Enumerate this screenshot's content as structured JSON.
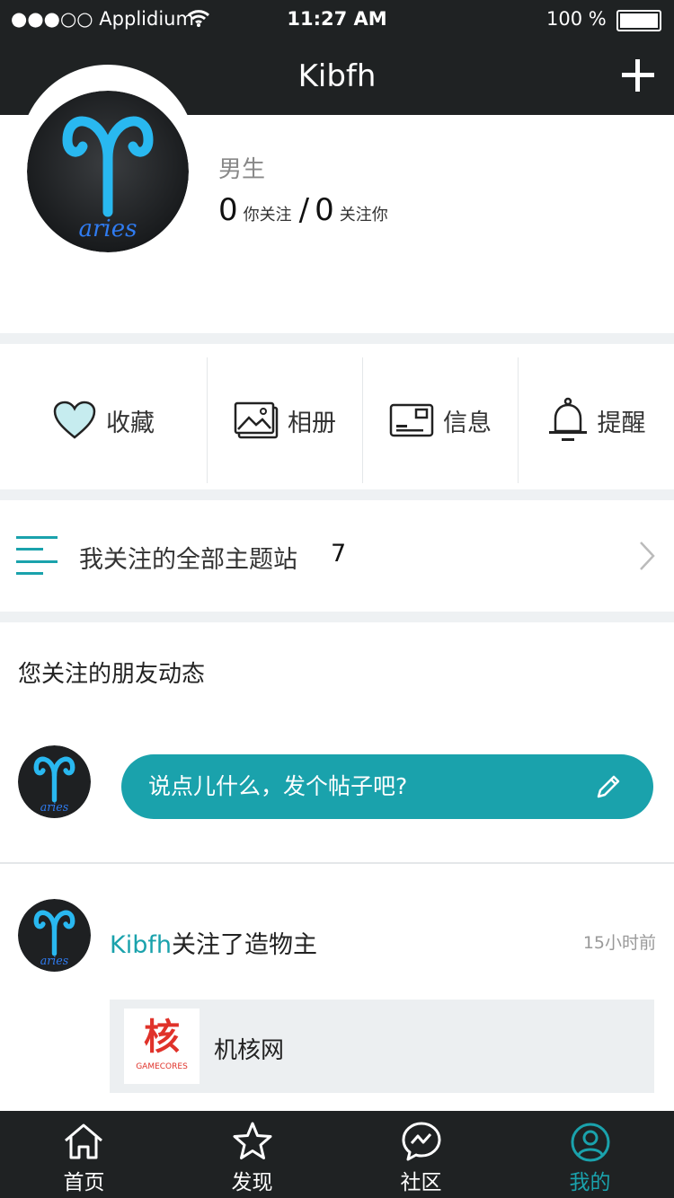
{
  "status_bar": {
    "carrier": "●●●○○ Applidium",
    "time": "11:27 AM",
    "battery": "100 %"
  },
  "nav": {
    "title": "Kibfh"
  },
  "profile": {
    "gender": "男生",
    "following_count": "0",
    "following_label": "你关注",
    "separator": "/",
    "followers_count": "0",
    "followers_label": "关注你",
    "avatar_text": "aries"
  },
  "menu": [
    {
      "label": "收藏",
      "icon": "heart-icon"
    },
    {
      "label": "相册",
      "icon": "album-icon"
    },
    {
      "label": "信息",
      "icon": "message-card-icon"
    },
    {
      "label": "提醒",
      "icon": "bell-icon"
    }
  ],
  "topics": {
    "label": "我关注的全部主题站",
    "count": "7"
  },
  "feed": {
    "section_title": "您关注的朋友动态",
    "compose_placeholder": "说点儿什么，发个帖子吧?",
    "items": [
      {
        "user": "Kibfh",
        "action": "关注了造物主",
        "time": "15小时前",
        "card_logo_char": "核",
        "card_logo_sub": "GAMECORES",
        "card_title": "机核网"
      }
    ]
  },
  "tabs": [
    {
      "label": "首页",
      "icon": "home-icon"
    },
    {
      "label": "发现",
      "icon": "star-icon"
    },
    {
      "label": "社区",
      "icon": "community-chat-icon"
    },
    {
      "label": "我的",
      "icon": "profile-icon",
      "active": true
    }
  ],
  "colors": {
    "accent": "#1aa2ac",
    "dark": "#1f2223",
    "band": "#eef1f3",
    "heart_fill": "#c6ecef"
  }
}
